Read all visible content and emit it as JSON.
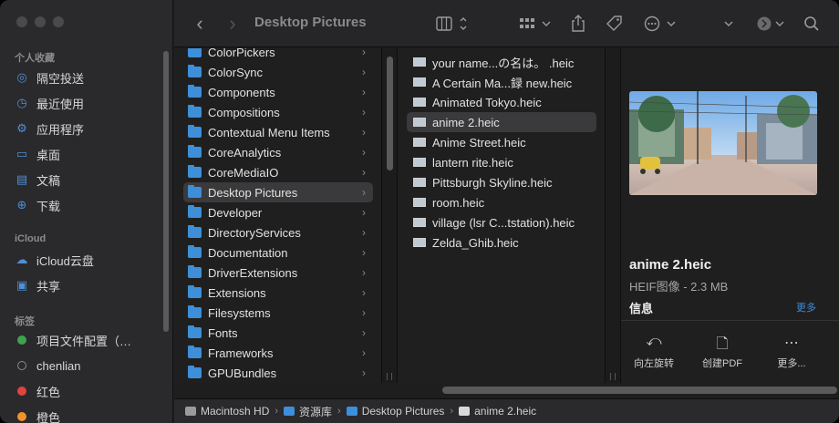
{
  "sidebar": {
    "favorites_header": "个人收藏",
    "favorites": [
      {
        "label": "隔空投送",
        "icon": "airdrop-icon",
        "glyph": "◎"
      },
      {
        "label": "最近使用",
        "icon": "clock-icon",
        "glyph": "◷"
      },
      {
        "label": "应用程序",
        "icon": "applications-icon",
        "glyph": "⚙"
      },
      {
        "label": "桌面",
        "icon": "desktop-icon",
        "glyph": "▭"
      },
      {
        "label": "文稿",
        "icon": "document-icon",
        "glyph": "▤"
      },
      {
        "label": "下载",
        "icon": "download-icon",
        "glyph": "⊕"
      }
    ],
    "icloud_header": "iCloud",
    "icloud": [
      {
        "label": "iCloud云盘",
        "icon": "cloud-icon",
        "glyph": "☁"
      },
      {
        "label": "共享",
        "icon": "shared-folder-icon",
        "glyph": "▣"
      }
    ],
    "tags_header": "标签",
    "tags": [
      {
        "label": "项目文件配置（…",
        "color": "#3fa34d"
      },
      {
        "label": "chenlian",
        "color": "transparent"
      },
      {
        "label": "红色",
        "color": "#e0443e"
      },
      {
        "label": "橙色",
        "color": "#f0932b"
      }
    ]
  },
  "toolbar": {
    "title": "Desktop Pictures",
    "back": "‹",
    "forward": "›"
  },
  "column1": {
    "items": [
      "ColorPickers",
      "ColorSync",
      "Components",
      "Compositions",
      "Contextual Menu Items",
      "CoreAnalytics",
      "CoreMediaIO",
      "Desktop Pictures",
      "Developer",
      "DirectoryServices",
      "Documentation",
      "DriverExtensions",
      "Extensions",
      "Filesystems",
      "Fonts",
      "Frameworks",
      "GPUBundles"
    ],
    "selected_index": 7
  },
  "column2": {
    "items": [
      "your name...の名は。 .heic",
      "A Certain Ma...録 new.heic",
      "Animated Tokyo.heic",
      "anime 2.heic",
      "Anime Street.heic",
      "lantern rite.heic",
      "Pittsburgh Skyline.heic",
      "room.heic",
      "village (lsr C...tstation).heic",
      "Zelda_Ghib.heic"
    ],
    "selected_index": 3
  },
  "preview": {
    "name": "anime 2.heic",
    "type": "HEIF图像 - 2.3 MB",
    "info_label": "信息",
    "more_label": "更多",
    "actions": [
      {
        "label": "向左旋转",
        "icon": "rotate-left-icon",
        "glyph": "⤺"
      },
      {
        "label": "创建PDF",
        "icon": "pdf-icon",
        "glyph": "🗋"
      },
      {
        "label": "更多...",
        "icon": "more-icon",
        "glyph": "⋯"
      }
    ]
  },
  "pathbar": {
    "items": [
      "Macintosh HD",
      "资源库",
      "Desktop Pictures",
      "anime 2.heic"
    ]
  }
}
